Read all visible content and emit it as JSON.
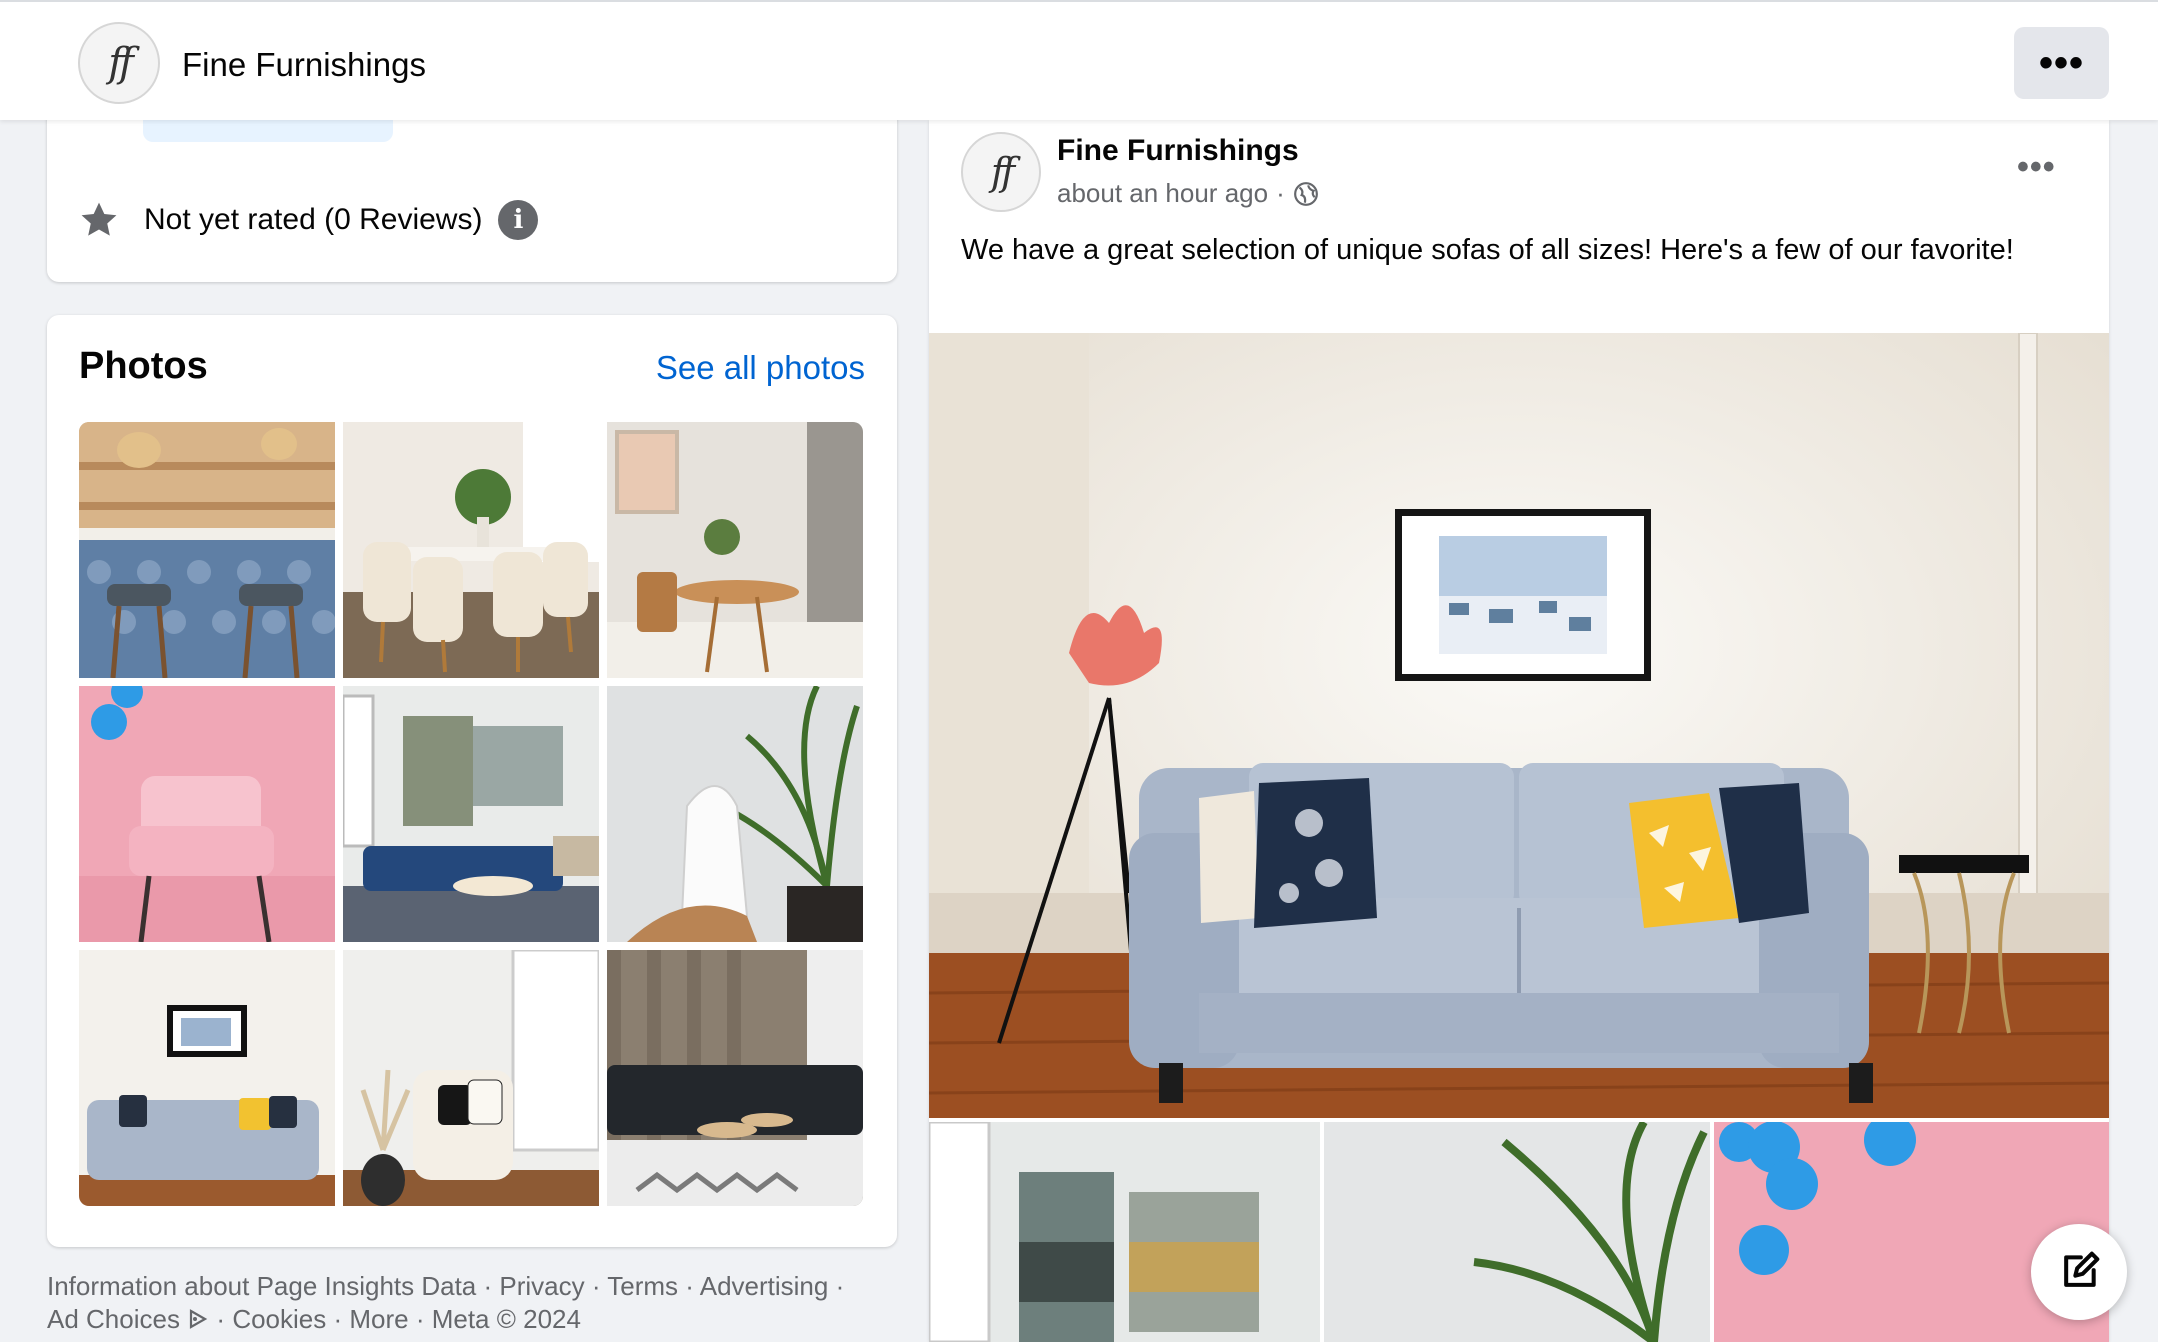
{
  "header": {
    "logo_text": "ff",
    "page_name": "Fine Furnishings",
    "more_label": "•••"
  },
  "rating": {
    "text": "Not yet rated (0 Reviews)",
    "info_label": "i",
    "star_icon": "star-icon",
    "info_icon": "info-icon"
  },
  "photos": {
    "title": "Photos",
    "see_all": "See all photos",
    "items": [
      {
        "subject": "kitchen with tiled island and bar stools"
      },
      {
        "subject": "dining table with white chairs"
      },
      {
        "subject": "round wooden dining table"
      },
      {
        "subject": "pink armchair with blue balloons"
      },
      {
        "subject": "blue sectional sofa living room"
      },
      {
        "subject": "white chair with palm plant"
      },
      {
        "subject": "light blue sofa with pillows"
      },
      {
        "subject": "cream armchair with pampas grass"
      },
      {
        "subject": "dark sectional sofa with coffee tables"
      }
    ]
  },
  "post": {
    "author": "Fine Furnishings",
    "time": "about an hour ago",
    "separator": "·",
    "audience_icon": "globe-icon",
    "more_label": "•••",
    "text": "We have a great selection of unique sofas of all sizes! Here's a few of our favorite!"
  },
  "footer": {
    "links": [
      "Information about Page Insights Data",
      "Privacy",
      "Terms",
      "Advertising",
      "Ad Choices",
      "Cookies",
      "More"
    ],
    "separator": " · ",
    "copyright": "Meta © 2024"
  },
  "fab": {
    "icon": "compose-icon"
  },
  "colors": {
    "link_blue": "#0064d1",
    "background": "#f0f2f5",
    "secondary_text": "#65676b",
    "sofa_blue": "#a9b6c9",
    "pink_wall": "#f0a7b6",
    "balloon_blue": "#2e9be6"
  }
}
